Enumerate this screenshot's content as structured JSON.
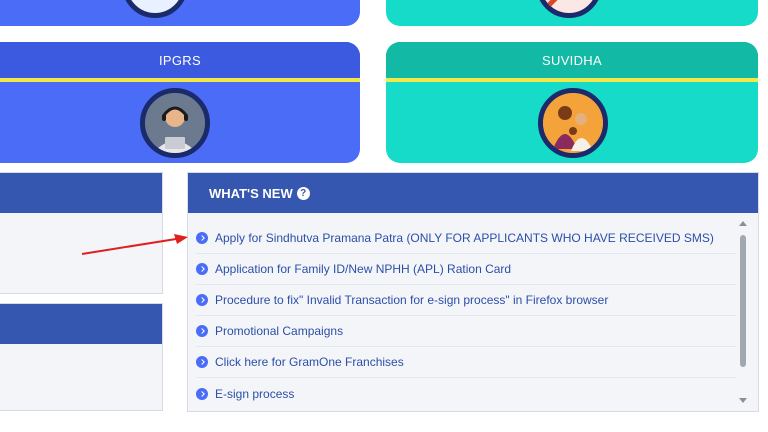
{
  "service_cards": [
    {
      "label": "IPGRS",
      "icon": "helpdesk-agent-icon",
      "color": "#4a6cf7"
    },
    {
      "label": "SUVIDHA",
      "icon": "family-icon",
      "color": "#16dbc8"
    }
  ],
  "whats_new": {
    "title": "WHAT'S NEW",
    "help_icon": "question-circle-icon",
    "help_glyph": "?",
    "items": [
      {
        "label": "Apply for Sindhutva Pramana Patra (ONLY FOR APPLICANTS WHO HAVE RECEIVED SMS)"
      },
      {
        "label": "Application for Family ID/New NPHH (APL) Ration Card"
      },
      {
        "label": "Procedure to fix\" Invalid Transaction for e-sign process\" in Firefox browser"
      },
      {
        "label": "Promotional Campaigns"
      },
      {
        "label": "Click here for GramOne Franchises"
      },
      {
        "label": "E-sign process"
      }
    ]
  },
  "colors": {
    "header_blue": "#3557b0",
    "card_blue": "#4a6cf7",
    "card_teal": "#16dbc8",
    "accent_yellow": "#f2e84a",
    "annotation_red": "#e02020",
    "link_blue": "#2b4fa8"
  }
}
